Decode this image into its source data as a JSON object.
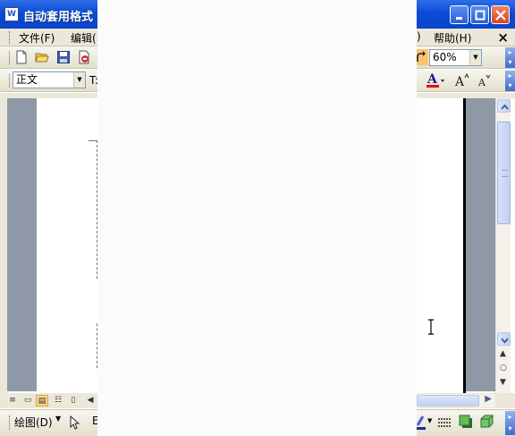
{
  "window": {
    "title": "自动套用格式"
  },
  "menu": {
    "items": [
      {
        "label": "文件(F)"
      },
      {
        "label": "编辑("
      },
      {
        "label": ")"
      },
      {
        "label": "帮助(H)"
      }
    ],
    "close_label": "×"
  },
  "toolbar_standard": {
    "zoom_value": "60%"
  },
  "toolbar_format": {
    "style_value": "正文",
    "font_partial": "T:"
  },
  "drawing_toolbar": {
    "draw_label": "绘图(D)",
    "partial_label": "E"
  },
  "icons": {
    "app": "word-document-icon",
    "minimize": "minimize-icon",
    "maximize": "maximize-icon",
    "close": "close-icon",
    "new": "new-document-icon",
    "open": "open-folder-icon",
    "save": "save-icon",
    "permission": "permission-icon",
    "redo": "redo-icon",
    "font_color": "font-color-icon",
    "grow_font": "grow-font-icon",
    "shrink_font": "shrink-font-icon",
    "text_cursor": "i-beam-cursor-icon"
  },
  "colors": {
    "titlebar": "#0a4bd6",
    "chrome": "#ebe8d9",
    "workspace": "#8e98a7",
    "overlay": "#fbfbfb",
    "font_color_bar": "#e81010"
  }
}
